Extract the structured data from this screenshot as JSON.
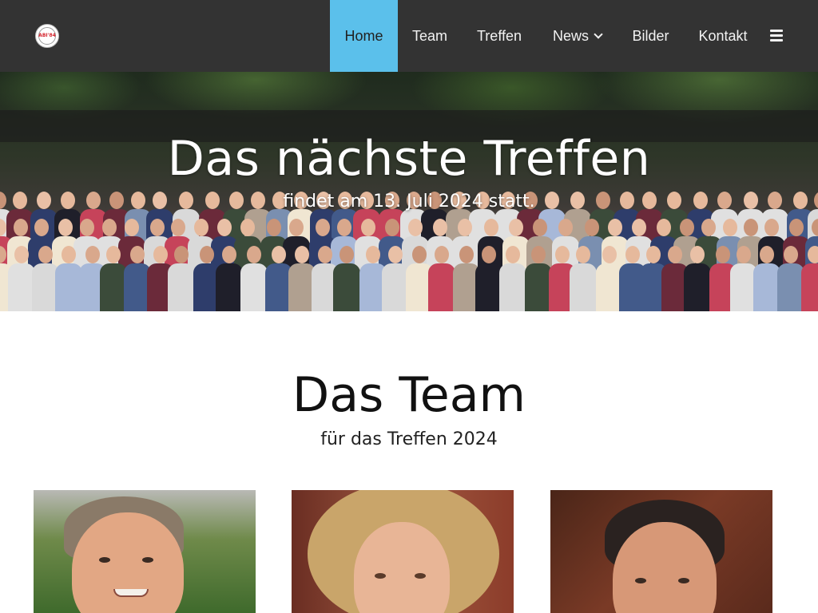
{
  "nav": {
    "items": [
      {
        "label": "Home",
        "active": true
      },
      {
        "label": "Team",
        "active": false
      },
      {
        "label": "Treffen",
        "active": false
      },
      {
        "label": "News",
        "active": false,
        "has_dropdown": true
      },
      {
        "label": "Bilder",
        "active": false
      },
      {
        "label": "Kontakt",
        "active": false
      }
    ],
    "menu_icon": "hamburger-icon",
    "logo_text": "ABI'84"
  },
  "hero": {
    "title": "Das nächste Treffen",
    "subtitle": "findet am 13. Juli 2024 statt."
  },
  "team": {
    "title": "Das Team",
    "subtitle": "für das Treffen 2024",
    "members": [
      {
        "photo": "team-member-photo"
      },
      {
        "photo": "team-member-photo"
      },
      {
        "photo": "team-member-photo"
      }
    ]
  },
  "colors": {
    "navbar_bg": "#333333",
    "nav_active_bg": "#5bc0eb",
    "nav_text": "#f2f2f2",
    "page_bg": "#ffffff"
  }
}
